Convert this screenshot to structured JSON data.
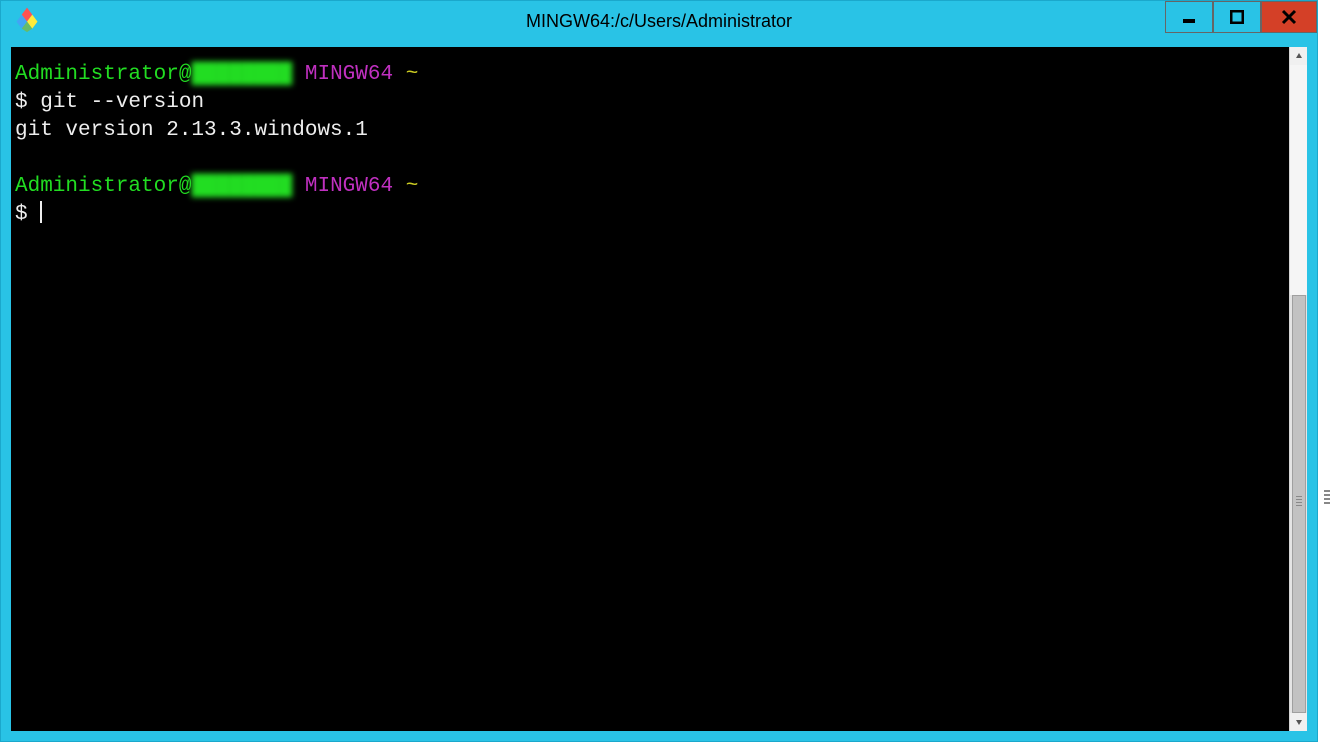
{
  "window": {
    "title": "MINGW64:/c/Users/Administrator"
  },
  "terminal": {
    "prompt1": {
      "user": "Administrator",
      "at": "@",
      "host": "████████",
      "space1": " ",
      "env": "MINGW64",
      "space2": " ",
      "path": "~",
      "line2_sym": "$ ",
      "line2_cmd": "git --version"
    },
    "output1": "git version 2.13.3.windows.1",
    "blank1": "",
    "prompt2": {
      "user": "Administrator",
      "at": "@",
      "host": "████████",
      "space1": " ",
      "env": "MINGW64",
      "space2": " ",
      "path": "~",
      "line2_sym": "$ "
    }
  }
}
